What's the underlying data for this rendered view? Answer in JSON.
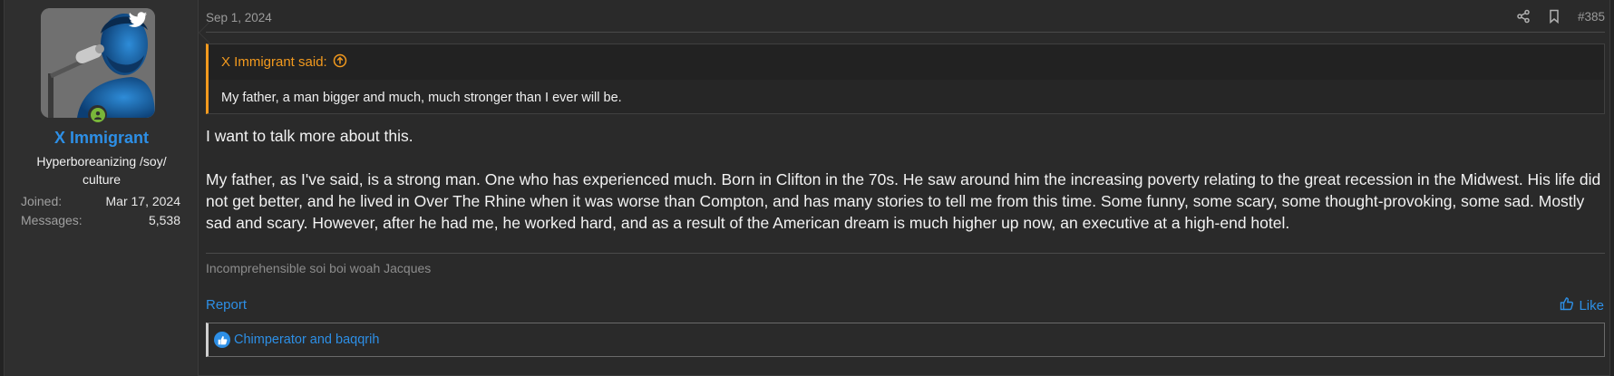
{
  "user": {
    "name": "X Immigrant",
    "title": "Hyperboreanizing /soy/ culture",
    "joined_label": "Joined:",
    "joined_value": "Mar 17, 2024",
    "messages_label": "Messages:",
    "messages_value": "5,538"
  },
  "post": {
    "date": "Sep 1, 2024",
    "number": "#385",
    "quote_author": "X Immigrant said:",
    "quote_text": "My father, a man bigger and much, much stronger than I ever will be.",
    "paragraphs": [
      "I want to talk more about this.",
      "My father, as I've said, is a strong man. One who has experienced much. Born in Clifton in the 70s. He saw around him the increasing poverty relating to the great recession in the Midwest. His life did not get better, and he lived in Over The Rhine when it was worse than Compton, and has many stories to tell me from this time. Some funny, some scary, some thought-provoking, some sad. Mostly sad and scary. However, after he had me, he worked hard, and as a result of the American dream is much higher up now, an executive at a high-end hotel."
    ],
    "signature": "Incomprehensible soi boi woah Jacques",
    "report_label": "Report",
    "like_label": "Like",
    "reactions_text": "Chimperator and baqqrih"
  },
  "colors": {
    "accent": "#2d8fe6",
    "quote_accent": "#f39a1e",
    "online": "#79b63a"
  }
}
